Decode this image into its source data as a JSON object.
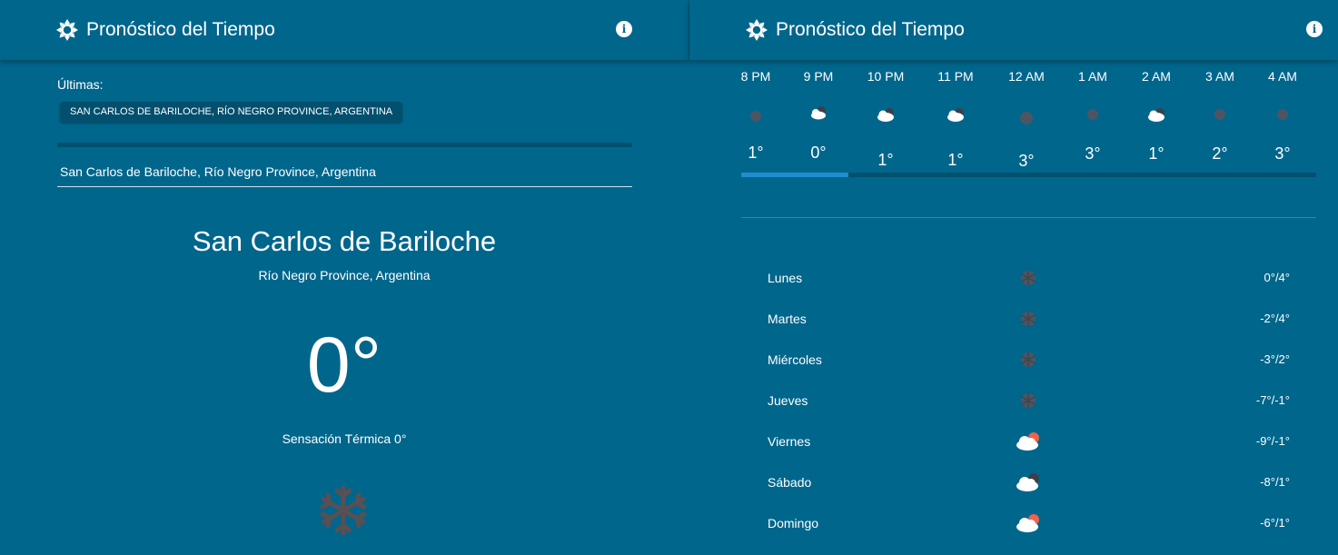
{
  "app": {
    "title": "Pronóstico del Tiempo"
  },
  "colors": {
    "background": "#00668c",
    "chip": "#024f6e",
    "track": "#02506d",
    "accent": "#1e8ed0",
    "snow": "#5a4f52"
  },
  "icons": {
    "header": "sun-icon",
    "info": "info-icon",
    "current": "snowflake-icon"
  },
  "left": {
    "recent_label": "Últimas:",
    "recent_chip": "SAN CARLOS DE BARILOCHE, RÍO NEGRO PROVINCE, ARGENTINA",
    "search_value": "San Carlos de Bariloche, Río Negro Province, Argentina",
    "city": "San Carlos de Bariloche",
    "region": "Río Negro Province, Argentina",
    "temperature": "0°",
    "feels_like": "Sensación Térmica 0°"
  },
  "hourly": [
    {
      "time": "8 PM",
      "temp": "1°",
      "icon": "snow-dot-icon"
    },
    {
      "time": "9 PM",
      "temp": "0°",
      "icon": "cloud-moon-icon"
    },
    {
      "time": "10 PM",
      "temp": "1°",
      "icon": "cloud-moon-icon"
    },
    {
      "time": "11 PM",
      "temp": "1°",
      "icon": "cloud-moon-icon"
    },
    {
      "time": "12 AM",
      "temp": "3°",
      "icon": "snow-dot-icon"
    },
    {
      "time": "1 AM",
      "temp": "3°",
      "icon": "snow-dot-icon"
    },
    {
      "time": "2 AM",
      "temp": "1°",
      "icon": "cloud-moon-icon"
    },
    {
      "time": "3 AM",
      "temp": "2°",
      "icon": "snow-dot-icon"
    },
    {
      "time": "4 AM",
      "temp": "3°",
      "icon": "snow-dot-icon"
    }
  ],
  "daily": [
    {
      "day": "Lunes",
      "temp": "0°/4°",
      "icon": "snow-icon"
    },
    {
      "day": "Martes",
      "temp": "-2°/4°",
      "icon": "snow-icon"
    },
    {
      "day": "Miércoles",
      "temp": "-3°/2°",
      "icon": "snow-icon"
    },
    {
      "day": "Jueves",
      "temp": "-7°/-1°",
      "icon": "snow-icon"
    },
    {
      "day": "Viernes",
      "temp": "-9°/-1°",
      "icon": "cloud-sun-icon"
    },
    {
      "day": "Sábado",
      "temp": "-8°/1°",
      "icon": "cloud-moon-icon"
    },
    {
      "day": "Domingo",
      "temp": "-6°/1°",
      "icon": "cloud-sun-icon"
    }
  ]
}
